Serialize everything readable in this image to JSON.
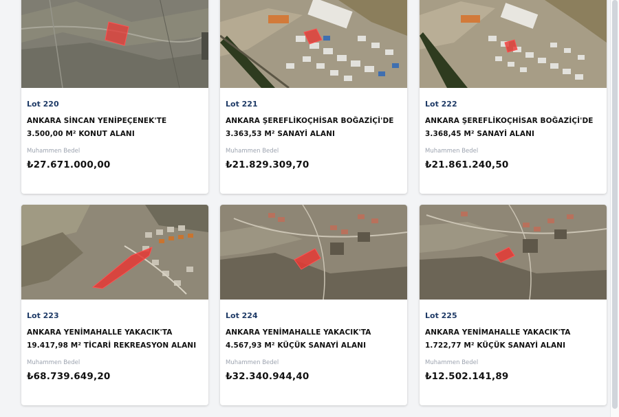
{
  "lots": [
    {
      "lot": "Lot 220",
      "title": "ANKARA SİNCAN YENİPEÇENEK'TE 3.500,00 M² KONUT ALANI",
      "price_label": "Muhammen Bedel",
      "price": "₺27.671.000,00",
      "image": "satellite-farmland"
    },
    {
      "lot": "Lot 221",
      "title": "ANKARA ŞEREFLİKOÇHİSAR BOĞAZİÇİ'DE 3.363,53 M² SANAYİ ALANI",
      "price_label": "Muhammen Bedel",
      "price": "₺21.829.309,70",
      "image": "satellite-industrial"
    },
    {
      "lot": "Lot 222",
      "title": "ANKARA ŞEREFLİKOÇHİSAR BOĞAZİÇİ'DE 3.368,45 M² SANAYİ ALANI",
      "price_label": "Muhammen Bedel",
      "price": "₺21.861.240,50",
      "image": "satellite-industrial"
    },
    {
      "lot": "Lot 223",
      "title": "ANKARA YENİMAHALLE YAKACIK'TA 19.417,98 M² TİCARİ REKREASYON ALANI",
      "price_label": "Muhammen Bedel",
      "price": "₺68.739.649,20",
      "image": "satellite-hillside"
    },
    {
      "lot": "Lot 224",
      "title": "ANKARA YENİMAHALLE YAKACIK'TA 4.567,93 M² KÜÇÜK SANAYİ ALANI",
      "price_label": "Muhammen Bedel",
      "price": "₺32.340.944,40",
      "image": "satellite-hillside"
    },
    {
      "lot": "Lot 225",
      "title": "ANKARA YENİMAHALLE YAKACIK'TA 1.722,77 M² KÜÇÜK SANAYİ ALANI",
      "price_label": "Muhammen Bedel",
      "price": "₺12.502.141,89",
      "image": "satellite-hillside"
    }
  ],
  "colors": {
    "lot_text": "#1e3a66",
    "parcel_highlight": "#e53935",
    "price_label": "#9ca3af"
  }
}
